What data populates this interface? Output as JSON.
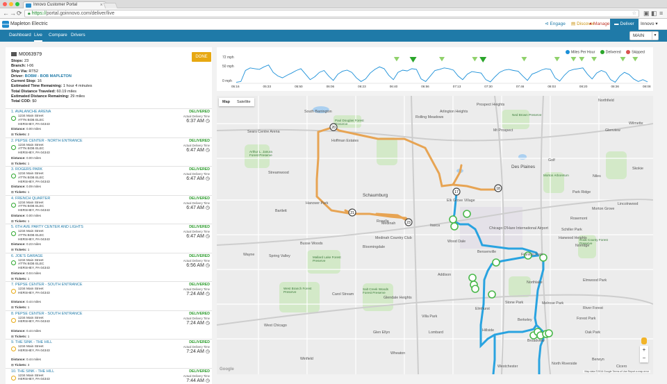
{
  "browser": {
    "tab_title": "Innovo Customer Portal",
    "url_secure": "https://",
    "url_rest": "portal.goinnovo.com/deliver/live"
  },
  "header": {
    "brand": "Mapleton Electric",
    "nav": [
      {
        "label": "Engage",
        "icon": "megaphone-icon",
        "color": "#1f7aa8"
      },
      {
        "label": "Discover",
        "icon": "chart-icon",
        "color": "#e7a812"
      },
      {
        "label": "Manage",
        "icon": "alert-icon",
        "color": "#c0392b"
      },
      {
        "label": "Deliver",
        "icon": "truck-icon",
        "color": "#ffffff"
      },
      {
        "label": "Innovo",
        "icon": "chevron-down-icon",
        "color": "#333333"
      }
    ]
  },
  "subnav": {
    "items": [
      "Dashboard",
      "Live",
      "Compare",
      "Drivers"
    ],
    "active": "Live",
    "select_value": "MAIN"
  },
  "route": {
    "id": "M0063979",
    "done_label": "DONE",
    "stops_label": "Stops:",
    "stops": "23",
    "branch_label": "Branch:",
    "branch": "I-06",
    "ship_via_label": "Ship Via:",
    "ship_via": "RT52",
    "driver_label": "Driver:",
    "driver": "BOBM - BOB MAPLETON",
    "current_stop_label": "Current Stop:",
    "current_stop": "16",
    "est_time_label": "Estimated Time Remaining:",
    "est_time": "1 hour 4 minutes",
    "total_distance_label": "Total Distance Traveled:",
    "total_distance": "60.19 miles",
    "est_distance_label": "Estimated Distance Remaining:",
    "est_distance": "29 miles",
    "total_cod_label": "Total COD:",
    "total_cod": "$0"
  },
  "stop_labels": {
    "status": "DELIVERED",
    "actual_time": "Actual Delivery Time",
    "address": "1234 Main Street",
    "attn": "ATTN BOB ELEC",
    "city": "HERSHEY, PA 04343",
    "distance": "Distance:",
    "tickets": "Tickets:"
  },
  "stops": [
    {
      "name": "1. AVALANCHE ARENA",
      "time": "6:37 AM",
      "distance": "0.00 miles",
      "tickets": "2",
      "attn": true
    },
    {
      "name": "2. PEPSE CENTER - NORTH ENTRANCE",
      "time": "6:47 AM",
      "distance": "0.00 miles",
      "tickets": "1",
      "attn": true
    },
    {
      "name": "3. ROGERS PARK",
      "time": "6:47 AM",
      "distance": "0.09 miles",
      "tickets": "1",
      "attn": true
    },
    {
      "name": "4. FRENCH QUARTER",
      "time": "6:47 AM",
      "distance": "0.00 miles",
      "tickets": "1",
      "attn": true
    },
    {
      "name": "5. 6TH AVE PARTY CENTER AND LIGHTS",
      "time": "6:47 AM",
      "distance": "0.23 miles",
      "tickets": "1",
      "attn": true
    },
    {
      "name": "6. JOE'S GARAGE",
      "time": "6:56 AM",
      "distance": "0.04 miles",
      "tickets": "1",
      "attn": true
    },
    {
      "name": "7. PEPSE CENTER - SOUTH ENTRANCE",
      "time": "7:24 AM",
      "distance": "0.44 miles",
      "tickets": "1",
      "attn": false
    },
    {
      "name": "8. PEPSE CENTER - SOUTH ENTRANCE",
      "time": "7:24 AM",
      "distance": "0.44 miles",
      "tickets": "1",
      "attn": false
    },
    {
      "name": "9. THE SINK - THE HILL",
      "time": "7:24 AM",
      "distance": "0.44 miles",
      "tickets": "3",
      "attn": false
    },
    {
      "name": "10. THE SINK - THE HILL",
      "time": "7:44 AM",
      "distance": "0.13 miles",
      "tickets": "",
      "attn": false
    }
  ],
  "speed_chart": {
    "legend": {
      "mph": "Miles Per Hour",
      "delivered": "Delivered",
      "skipped": "Skipped"
    },
    "colors": {
      "line": "#1a8fd8",
      "delivered": "#2aa52a",
      "skipped": "#d9534f",
      "marker": "#8fd16a"
    },
    "y_top_label": "72 mph",
    "y_mid_label": "50 mph",
    "y_bottom_label": "0 mph",
    "ymax": 72,
    "x_ticks": [
      "05:16",
      "05:33",
      "05:50",
      "06:06",
      "06:23",
      "06:40",
      "06:56",
      "07:13",
      "07:30",
      "07:46",
      "08:03",
      "08:20",
      "08:36",
      "08:08"
    ],
    "delivery_markers_fraction": [
      0.39,
      0.43,
      0.5,
      0.58,
      0.6,
      0.7,
      0.78,
      0.82,
      0.84,
      0.87,
      0.94,
      0.97
    ],
    "series": [
      {
        "values": [
          3,
          5,
          35,
          42,
          40,
          38,
          45,
          50,
          30,
          20,
          15,
          22,
          28,
          35,
          40,
          25,
          10,
          18,
          30,
          35,
          20,
          8,
          25,
          33,
          36,
          30,
          15,
          5,
          12,
          28,
          38,
          45,
          40,
          22,
          10,
          30,
          36,
          34,
          40,
          38,
          12,
          5,
          20,
          35,
          38,
          42,
          40,
          36,
          20,
          10,
          25,
          32,
          30,
          28,
          10,
          4,
          18,
          30,
          36,
          38,
          35,
          33,
          20,
          8,
          25,
          30,
          36,
          40,
          38,
          15,
          6,
          22,
          34,
          38,
          40,
          42,
          25,
          12,
          28,
          35,
          30,
          10,
          3,
          20,
          30,
          24,
          12,
          5,
          10,
          4
        ]
      }
    ]
  },
  "map": {
    "type_labels": [
      "Map",
      "Satellite"
    ],
    "active_type": "Map",
    "attribution": "Map data ©2016 Google   Terms of Use   Report a map error",
    "logo": "Google",
    "place_labels": [
      {
        "t": "Schaumburg",
        "big": true
      },
      {
        "t": "Des Plaines",
        "big": true
      },
      {
        "t": "Elk Grove Village",
        "big": false
      },
      {
        "t": "Park Ridge",
        "big": false
      },
      {
        "t": "Hoffman Estates",
        "big": false
      },
      {
        "t": "Streamwood",
        "big": false
      },
      {
        "t": "Bartlett",
        "big": false
      },
      {
        "t": "Roselle",
        "big": false
      },
      {
        "t": "Itasca",
        "big": false
      },
      {
        "t": "Wood Dale",
        "big": false
      },
      {
        "t": "Bensenville",
        "big": false
      },
      {
        "t": "Franklin Park",
        "big": false
      },
      {
        "t": "Bloomingdale",
        "big": false
      },
      {
        "t": "Addison",
        "big": false
      },
      {
        "t": "Carol Stream",
        "big": false
      },
      {
        "t": "Glendale Heights",
        "big": false
      },
      {
        "t": "Elmhurst",
        "big": false
      },
      {
        "t": "Melrose Park",
        "big": false
      },
      {
        "t": "Villa Park",
        "big": false
      },
      {
        "t": "Lombard",
        "big": false
      },
      {
        "t": "Glen Ellyn",
        "big": false
      },
      {
        "t": "Wheaton",
        "big": false
      },
      {
        "t": "West Chicago",
        "big": false
      },
      {
        "t": "Winfield",
        "big": false
      },
      {
        "t": "Broadview",
        "big": false
      },
      {
        "t": "Berwyn",
        "big": false
      },
      {
        "t": "Oak Park",
        "big": false
      },
      {
        "t": "Forest Park",
        "big": false
      },
      {
        "t": "River Forest",
        "big": false
      },
      {
        "t": "Elmwood Park",
        "big": false
      },
      {
        "t": "Norridge",
        "big": false
      },
      {
        "t": "Harwood Heights",
        "big": false
      },
      {
        "t": "Niles",
        "big": false
      },
      {
        "t": "Skokie",
        "big": false
      },
      {
        "t": "Glenview",
        "big": false
      },
      {
        "t": "Mt Prospect",
        "big": false
      },
      {
        "t": "Arlington Heights",
        "big": false
      },
      {
        "t": "Rolling Meadows",
        "big": false
      },
      {
        "t": "Prospect Heights",
        "big": false
      },
      {
        "t": "South Barrington",
        "big": false
      },
      {
        "t": "Hanover Park",
        "big": false
      },
      {
        "t": "Medinah",
        "big": false
      },
      {
        "t": "Wayne",
        "big": false
      },
      {
        "t": "Northfield",
        "big": false
      },
      {
        "t": "Wilmette",
        "big": false
      },
      {
        "t": "Lincolnwood",
        "big": false
      },
      {
        "t": "Golf",
        "big": false
      },
      {
        "t": "Chicago O'Hare International Airport",
        "big": false
      },
      {
        "t": "Northlake",
        "big": false
      },
      {
        "t": "Stone Park",
        "big": false
      },
      {
        "t": "Berkeley",
        "big": false
      },
      {
        "t": "Hillside",
        "big": false
      },
      {
        "t": "Westchester",
        "big": false
      },
      {
        "t": "North Riverside",
        "big": false
      },
      {
        "t": "Cicero",
        "big": false
      },
      {
        "t": "Medinah Country Club",
        "big": false
      },
      {
        "t": "Schiller Park",
        "big": false
      },
      {
        "t": "Rosemont",
        "big": false
      },
      {
        "t": "Sears Centre Arena",
        "big": false
      },
      {
        "t": "Spring Valley",
        "big": false
      },
      {
        "t": "Busse Woods",
        "big": false
      },
      {
        "t": "Morton Grove",
        "big": false
      }
    ],
    "green_labels": [
      "Paul Douglas Forest Preserve",
      "Ned Brown Preserve",
      "Arthur L. Janura Forest Preserve",
      "Mallard Lake Forest Preserve",
      "West Branch Forest Preserve",
      "Salt Creek Woods Forest Preserve",
      "Morton Arboretum",
      "Cook County Forest Preserve"
    ],
    "route_markers": [
      "20",
      "17",
      "18",
      "23",
      "21"
    ],
    "route_colors": {
      "planned": "#e7a453",
      "driven": "#29a3e0",
      "stop": "#49b84a"
    }
  }
}
